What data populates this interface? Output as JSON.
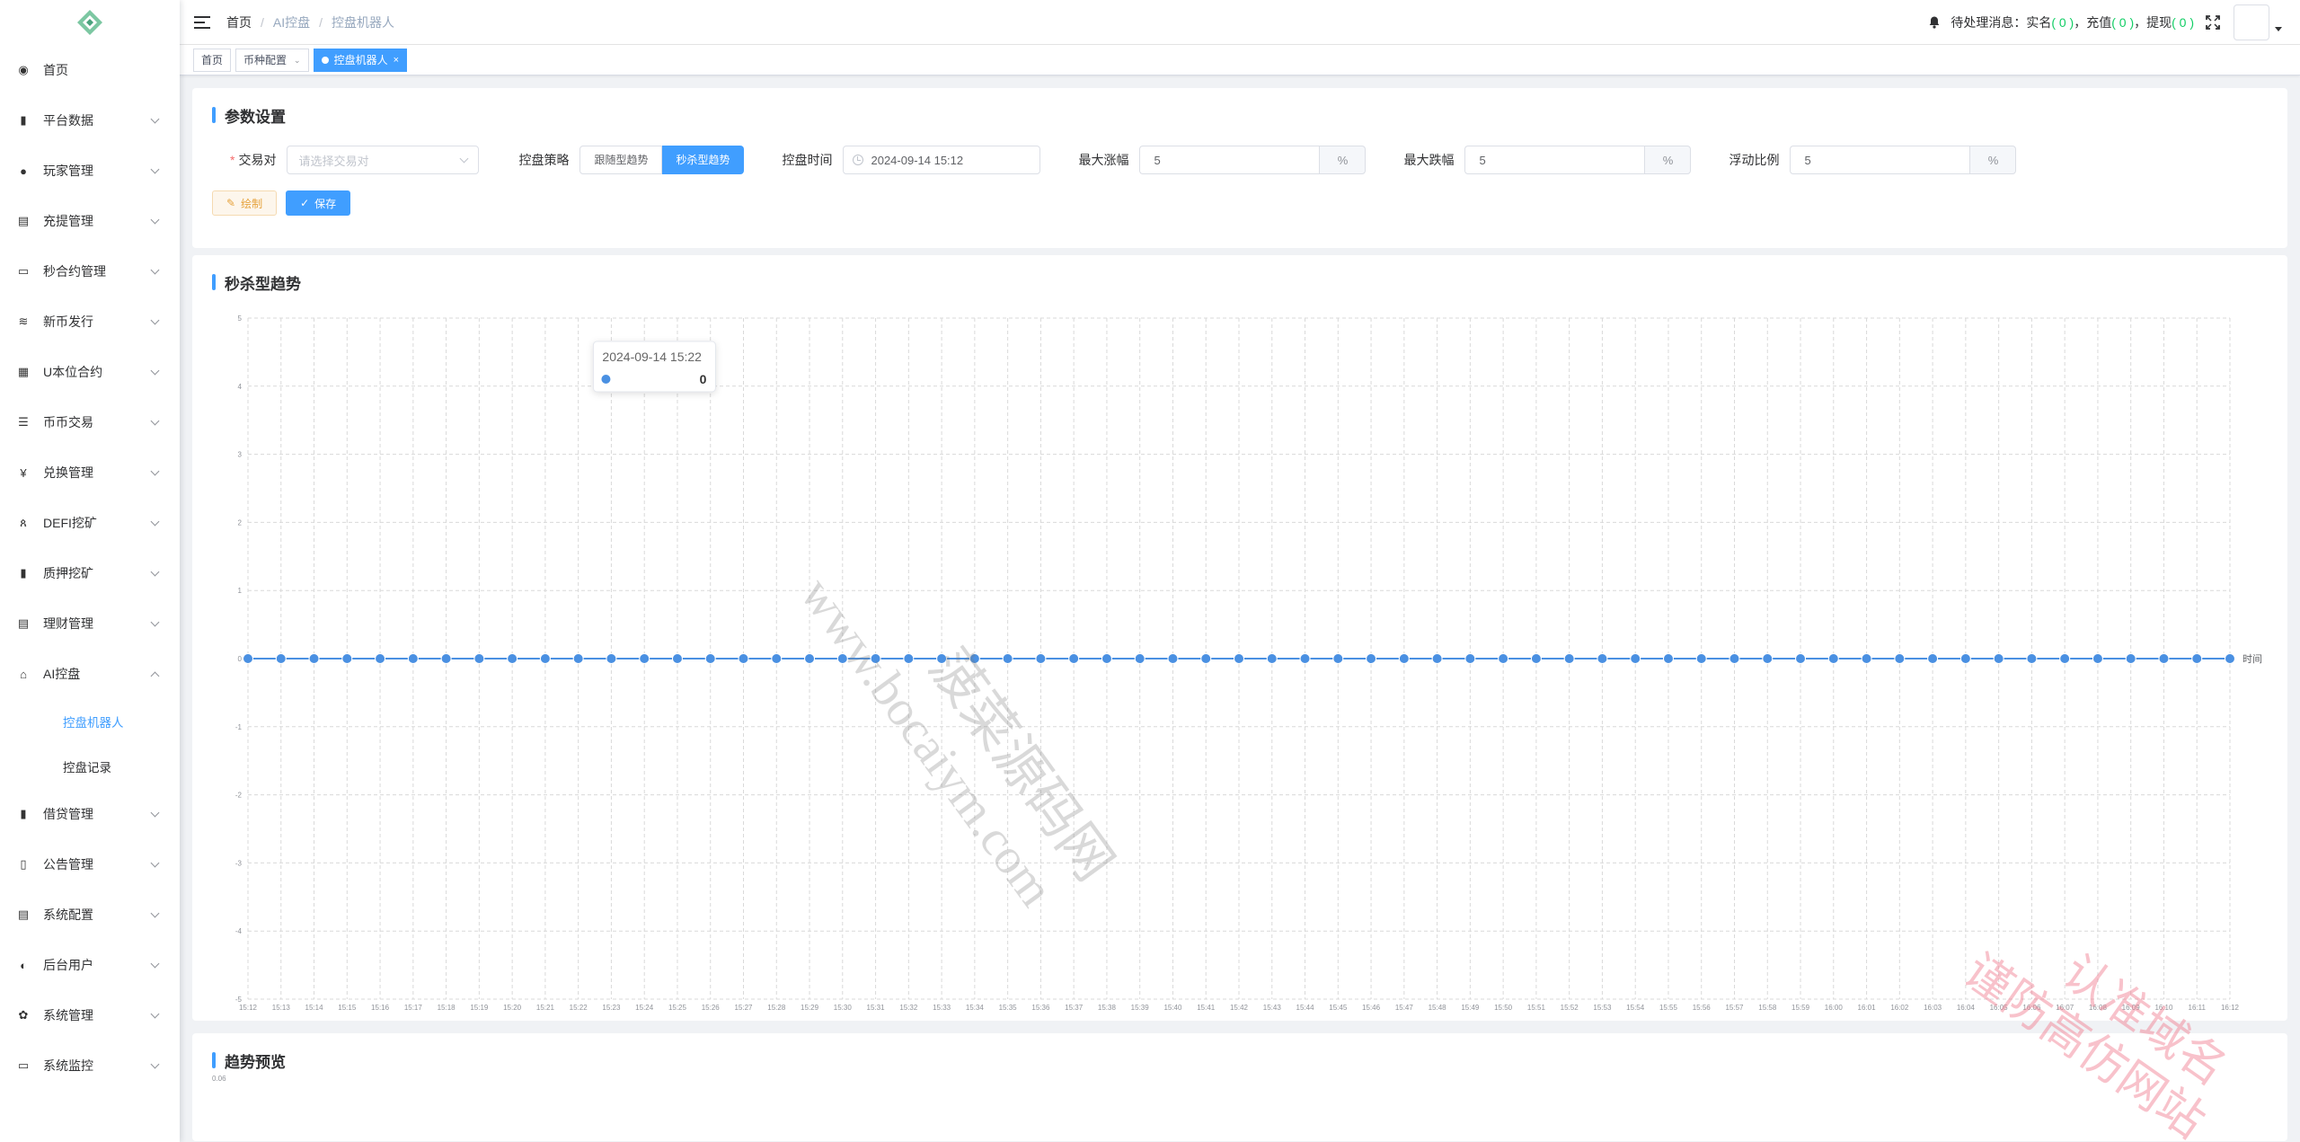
{
  "header": {
    "breadcrumb": [
      "首页",
      "AI控盘",
      "控盘机器人"
    ],
    "notice_label": "待处理消息：",
    "notice_items": [
      {
        "label": "实名",
        "count": "( 0 )"
      },
      {
        "label": "充值",
        "count": "( 0 )"
      },
      {
        "label": "提现",
        "count": "( 0 )"
      }
    ],
    "notice_sep": "，"
  },
  "sidebar": {
    "items": [
      {
        "label": "首页",
        "icon": "dashboard-icon"
      },
      {
        "label": "平台数据",
        "icon": "book-icon"
      },
      {
        "label": "玩家管理",
        "icon": "user-icon"
      },
      {
        "label": "充提管理",
        "icon": "documents-icon"
      },
      {
        "label": "秒合约管理",
        "icon": "monitor-icon"
      },
      {
        "label": "新币发行",
        "icon": "coin-icon"
      },
      {
        "label": "U本位合约",
        "icon": "grid-icon"
      },
      {
        "label": "币币交易",
        "icon": "list-icon"
      },
      {
        "label": "兑换管理",
        "icon": "yen-icon"
      },
      {
        "label": "DEFI挖矿",
        "icon": "people-icon"
      },
      {
        "label": "质押挖矿",
        "icon": "bar-chart-icon"
      },
      {
        "label": "理财管理",
        "icon": "notebook-icon"
      },
      {
        "label": "AI控盘",
        "icon": "robot-icon"
      }
    ],
    "ai_submenu": [
      "控盘机器人",
      "控盘记录"
    ],
    "items_after": [
      {
        "label": "借贷管理",
        "icon": "book-icon"
      },
      {
        "label": "公告管理",
        "icon": "open-book-icon"
      },
      {
        "label": "系统配置",
        "icon": "form-icon"
      },
      {
        "label": "后台用户",
        "icon": "users-icon"
      },
      {
        "label": "系统管理",
        "icon": "gear-icon"
      },
      {
        "label": "系统监控",
        "icon": "monitor-icon"
      }
    ]
  },
  "tags": {
    "home": "首页",
    "coin_config": "币种配置",
    "active": "控盘机器人"
  },
  "params": {
    "title": "参数设置",
    "pair_label": "交易对",
    "pair_placeholder": "请选择交易对",
    "strategy_label": "控盘策略",
    "strategy_options": [
      "跟随型趋势",
      "秒杀型趋势"
    ],
    "strategy_selected": "秒杀型趋势",
    "time_label": "控盘时间",
    "time_value": "2024-09-14 15:12",
    "max_rise_label": "最大涨幅",
    "max_rise_value": "5",
    "max_fall_label": "最大跌幅",
    "max_fall_value": "5",
    "float_label": "浮动比例",
    "float_value": "5",
    "unit": "%",
    "draw_button": "绘制",
    "save_button": "保存"
  },
  "chart_section": {
    "title": "秒杀型趋势",
    "tooltip_time": "2024-09-14 15:22",
    "tooltip_value": "0"
  },
  "preview_section": {
    "title": "趋势预览",
    "first_tick": "0.06"
  },
  "watermarks": {
    "center_cn": "菠菜源码网",
    "center_url": "www.bocaiym.com",
    "corner_line1": "认准域名",
    "corner_line2": "谨防高仿网站"
  },
  "chart_data": {
    "type": "line",
    "xlabel": "时间",
    "ylabel": "",
    "ylim": [
      -5,
      5
    ],
    "yticks": [
      5,
      4,
      3,
      2,
      1,
      0,
      -1,
      -2,
      -3,
      -4,
      -5
    ],
    "x": [
      "15:12",
      "15:13",
      "15:14",
      "15:15",
      "15:16",
      "15:17",
      "15:18",
      "15:19",
      "15:20",
      "15:21",
      "15:22",
      "15:23",
      "15:24",
      "15:25",
      "15:26",
      "15:27",
      "15:28",
      "15:29",
      "15:30",
      "15:31",
      "15:32",
      "15:33",
      "15:34",
      "15:35",
      "15:36",
      "15:37",
      "15:38",
      "15:39",
      "15:40",
      "15:41",
      "15:42",
      "15:43",
      "15:44",
      "15:45",
      "15:46",
      "15:47",
      "15:48",
      "15:49",
      "15:50",
      "15:51",
      "15:52",
      "15:53",
      "15:54",
      "15:55",
      "15:56",
      "15:57",
      "15:58",
      "15:59",
      "16:00",
      "16:01",
      "16:02",
      "16:03",
      "16:04",
      "16:05",
      "16:06",
      "16:07",
      "16:08",
      "16:09",
      "16:10",
      "16:11",
      "16:12"
    ],
    "series": [
      {
        "values": [
          0,
          0,
          0,
          0,
          0,
          0,
          0,
          0,
          0,
          0,
          0,
          0,
          0,
          0,
          0,
          0,
          0,
          0,
          0,
          0,
          0,
          0,
          0,
          0,
          0,
          0,
          0,
          0,
          0,
          0,
          0,
          0,
          0,
          0,
          0,
          0,
          0,
          0,
          0,
          0,
          0,
          0,
          0,
          0,
          0,
          0,
          0,
          0,
          0,
          0,
          0,
          0,
          0,
          0,
          0,
          0,
          0,
          0,
          0,
          0,
          0
        ]
      }
    ],
    "color": "#4a90e2",
    "grid": true
  }
}
